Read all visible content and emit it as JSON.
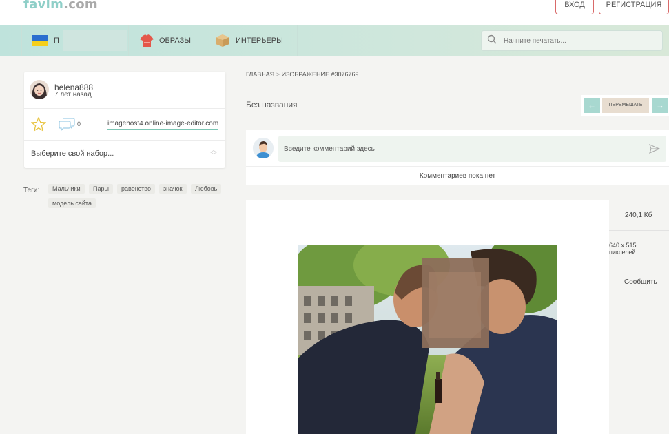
{
  "header": {
    "logo_text": "favim",
    "logo_domain": ".com",
    "login_label": "ВХОД",
    "register_label": "РЕГИСТРАЦИЯ"
  },
  "nav": {
    "first_label_visible": "П",
    "looks_label": "ОБРАЗЫ",
    "interiors_label": "ИНТЕРЬЕРЫ",
    "search_placeholder": "Начните печатать..."
  },
  "user": {
    "name": "helena888",
    "posted": "7 лет назад",
    "comment_count": "0",
    "source": "imagehost4.online-image-editor.com",
    "set_select": "Выберите свой набор..."
  },
  "tags": {
    "label": "Теги:",
    "items": [
      "Мальчики",
      "Пары",
      "равенство",
      "значок",
      "Любовь",
      "модель сайта"
    ]
  },
  "breadcrumb": {
    "home": "ГЛАВНАЯ",
    "sep": ">",
    "current": "ИЗОБРАЖЕНИЕ #3076769"
  },
  "image": {
    "title": "Без названия",
    "prev_arrow": "←",
    "shuffle": "ПЕРЕМЕШАТЬ",
    "next_arrow": "→"
  },
  "comments": {
    "placeholder": "Введите комментарий здесь",
    "empty": "Комментариев пока нет"
  },
  "details": {
    "size": "240,1 Кб",
    "dimensions_line1": "640 x 515",
    "dimensions_line2": "пикселей.",
    "report": "Сообщить"
  },
  "colors": {
    "accent": "#8fcfc8",
    "nav_bg": "#c7e5dd",
    "button_border": "#d96a6a"
  }
}
